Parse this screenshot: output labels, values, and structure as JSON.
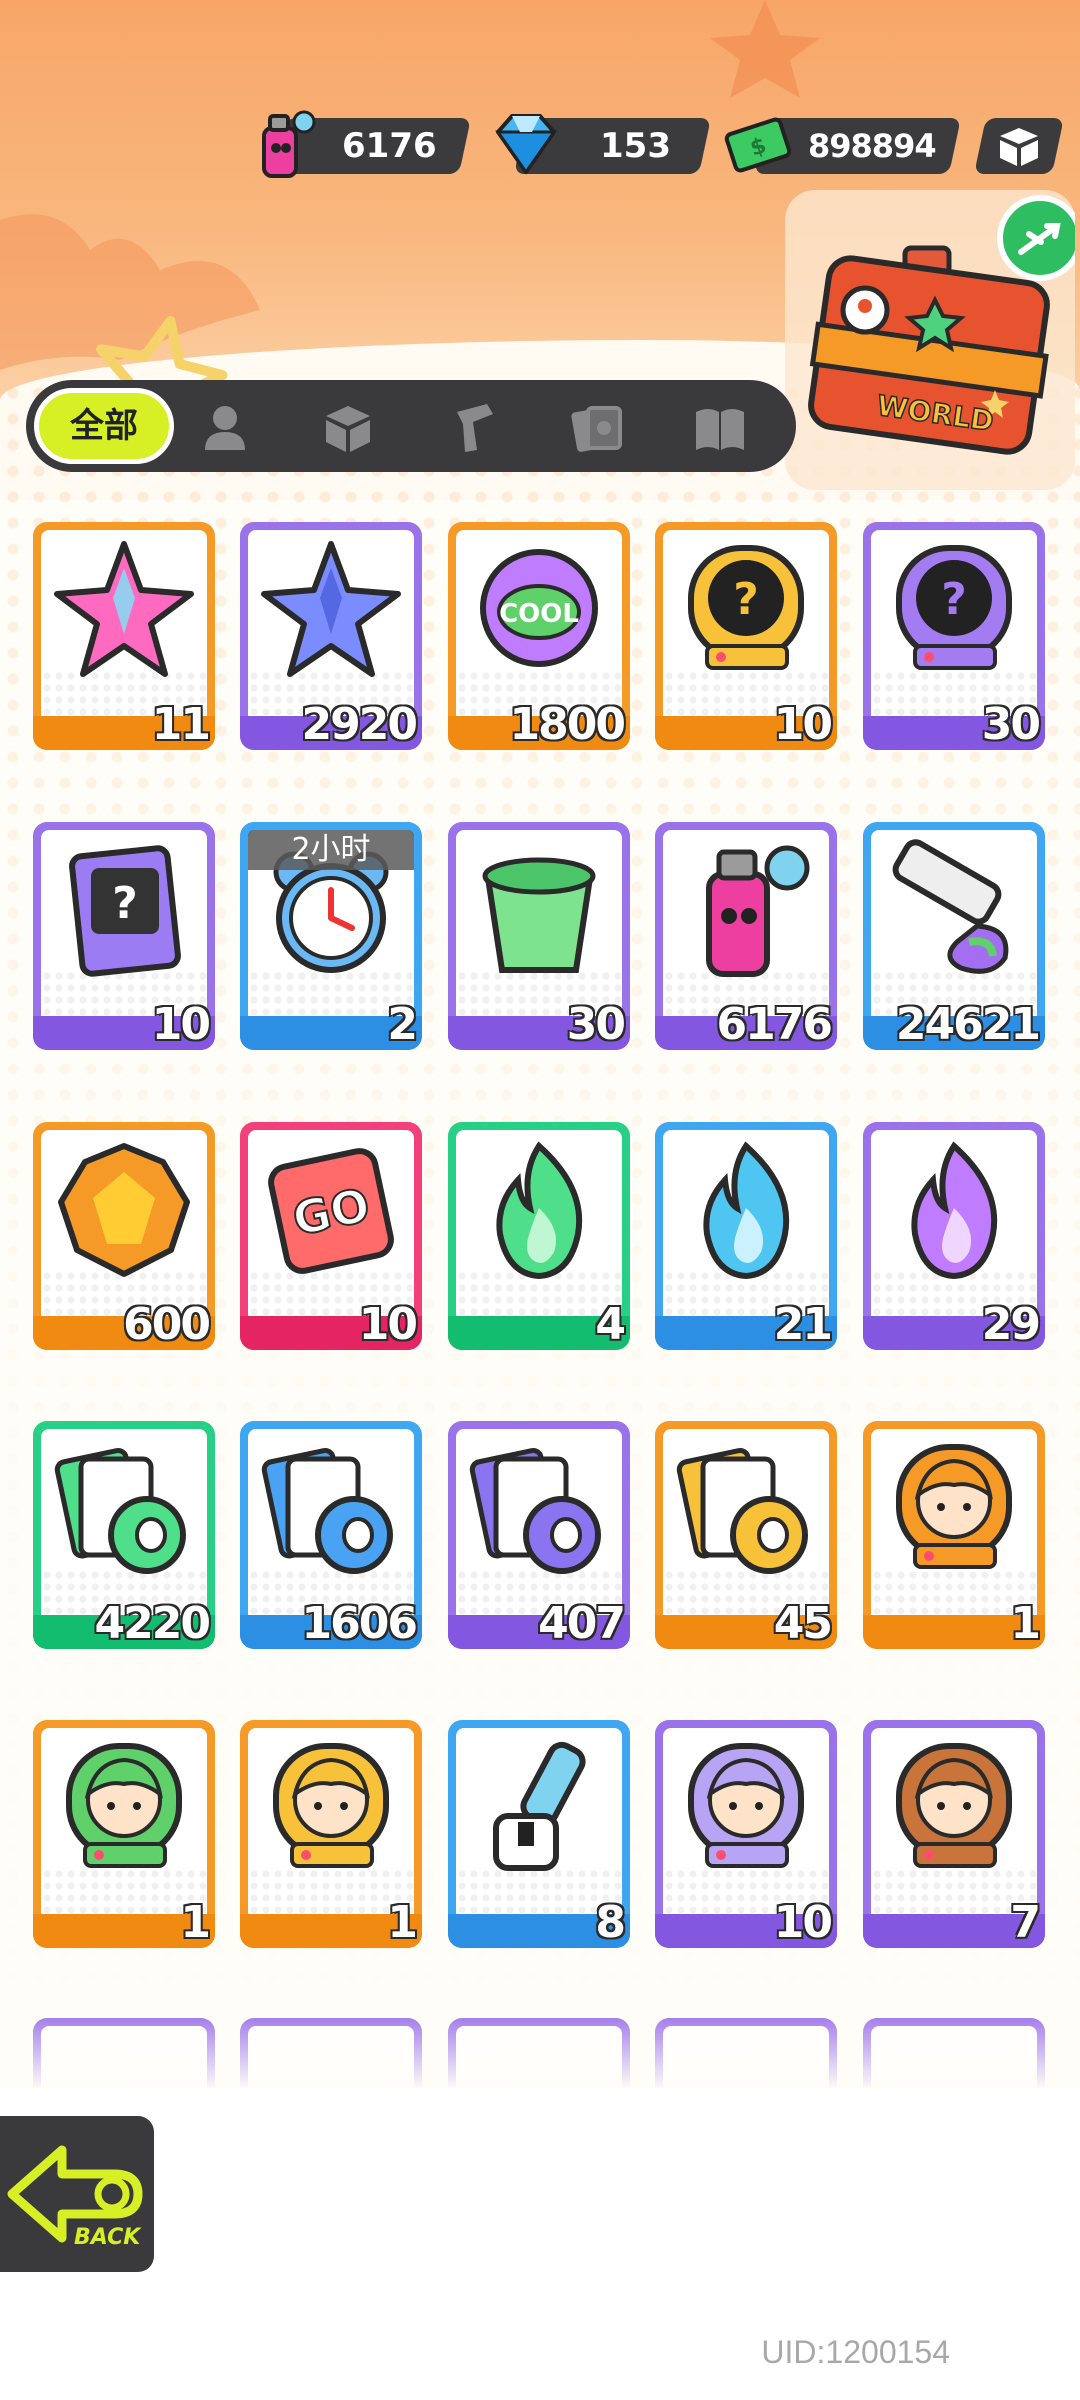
{
  "currency": {
    "paint": {
      "value": "6176",
      "icon": "spray-can-icon"
    },
    "gems": {
      "value": "153",
      "icon": "diamond-icon"
    },
    "cash": {
      "value": "898894",
      "icon": "cash-icon"
    },
    "settings_icon": "box-icon"
  },
  "world_box": {
    "label": "WORLD"
  },
  "tabs": {
    "active_label": "全部",
    "icons": [
      "character-icon",
      "box-icon",
      "spray-gun-icon",
      "card-stack-icon",
      "book-icon"
    ]
  },
  "items": [
    {
      "icon": "rainbow-star-icon",
      "count": "11",
      "color": "orange"
    },
    {
      "icon": "blue-star-icon",
      "count": "2920",
      "color": "purple"
    },
    {
      "icon": "cool-badge-icon",
      "count": "1800",
      "color": "orange"
    },
    {
      "icon": "deity-mystery-gold-icon",
      "count": "10",
      "color": "orange"
    },
    {
      "icon": "deity-mystery-purple-icon",
      "count": "30",
      "color": "purple"
    },
    {
      "icon": "travel-card-icon",
      "count": "10",
      "color": "purple"
    },
    {
      "icon": "alarm-clock-icon",
      "count": "2",
      "color": "blue",
      "timer": "2小时"
    },
    {
      "icon": "open-jelly-cup-icon",
      "count": "30",
      "color": "purple"
    },
    {
      "icon": "spray-can-icon",
      "count": "6176",
      "color": "purple"
    },
    {
      "icon": "paint-tube-icon",
      "count": "24621",
      "color": "blue"
    },
    {
      "icon": "gold-gem-icon",
      "count": "600",
      "color": "orange"
    },
    {
      "icon": "go-dice-icon",
      "count": "10",
      "color": "pink"
    },
    {
      "icon": "green-flame-icon",
      "count": "4",
      "color": "green"
    },
    {
      "icon": "blue-flame-icon",
      "count": "21",
      "color": "blue"
    },
    {
      "icon": "purple-flame-icon",
      "count": "29",
      "color": "purple"
    },
    {
      "icon": "green-card-pack-icon",
      "count": "4220",
      "color": "green"
    },
    {
      "icon": "blue-card-pack-icon",
      "count": "1606",
      "color": "blue"
    },
    {
      "icon": "purple-card-pack-icon",
      "count": "407",
      "color": "purple"
    },
    {
      "icon": "gold-card-pack-icon",
      "count": "45",
      "color": "orange"
    },
    {
      "icon": "deity-orange-hair-icon",
      "count": "1",
      "color": "orange"
    },
    {
      "icon": "deity-green-hair-icon",
      "count": "1",
      "color": "orange"
    },
    {
      "icon": "deity-cap-icon",
      "count": "1",
      "color": "orange"
    },
    {
      "icon": "usb-key-icon",
      "count": "8",
      "color": "blue"
    },
    {
      "icon": "deity-lavender-hair-icon",
      "count": "10",
      "color": "purple"
    },
    {
      "icon": "deity-goggles-icon",
      "count": "7",
      "color": "purple"
    },
    {
      "icon": "partial-item-icon",
      "count": "",
      "color": "purple"
    },
    {
      "icon": "partial-item-icon",
      "count": "",
      "color": "purple"
    },
    {
      "icon": "partial-item-icon",
      "count": "",
      "color": "purple"
    },
    {
      "icon": "partial-item-icon",
      "count": "",
      "color": "purple"
    },
    {
      "icon": "partial-item-icon",
      "count": "",
      "color": "purple"
    }
  ],
  "back_button": {
    "label": "BACK",
    "icon": "back-arrow-icon"
  },
  "uid": "UID:1200154"
}
